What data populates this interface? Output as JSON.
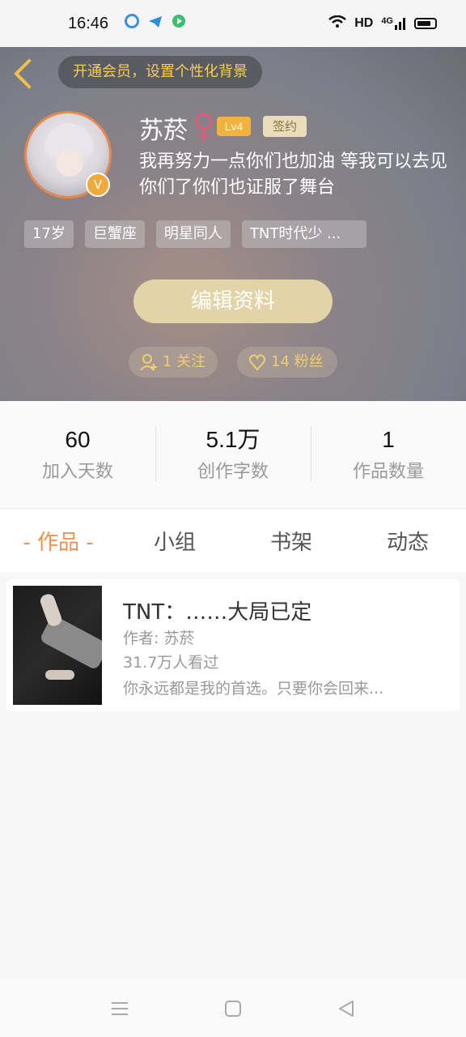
{
  "status_bar": {
    "time": "16:46",
    "network": "HD",
    "signal_label": "4G",
    "icons": [
      "browser-app-icon",
      "telegram-app-icon",
      "video-app-icon",
      "wifi-icon",
      "signal-icon",
      "battery-icon"
    ]
  },
  "header": {
    "vip_banner": "开通会员，设置个性化背景",
    "username": "苏菸",
    "gender": "female",
    "level": "Lv4",
    "sign_badge": "签约",
    "bio": "我再努力一点你们也加油 等我可以去见你们了你们也证服了舞台",
    "tags": [
      "17岁",
      "巨蟹座",
      "明星同人",
      "TNT时代少 ..."
    ],
    "edit_button": "编辑资料",
    "follow": "1 关注",
    "fans": "14 粉丝",
    "colors": {
      "accent": "#f3cf58",
      "gender": "#e05a7a",
      "level": "#f1b33e",
      "vip": "#f1a93a"
    }
  },
  "stats": [
    {
      "value": "60",
      "label": "加入天数"
    },
    {
      "value": "5.1万",
      "label": "创作字数"
    },
    {
      "value": "1",
      "label": "作品数量"
    }
  ],
  "tabs": [
    {
      "label": "- 作品 -",
      "active": true
    },
    {
      "label": "小组",
      "active": false
    },
    {
      "label": "书架",
      "active": false
    },
    {
      "label": "动态",
      "active": false
    }
  ],
  "works": [
    {
      "title": "TNT：……大局已定",
      "author": "作者: 苏菸",
      "views": "31.7万人看过",
      "desc": "你永远都是我的首选。只要你会回来..."
    }
  ],
  "nav": [
    "menu-icon",
    "home-icon",
    "back-triangle-icon"
  ]
}
